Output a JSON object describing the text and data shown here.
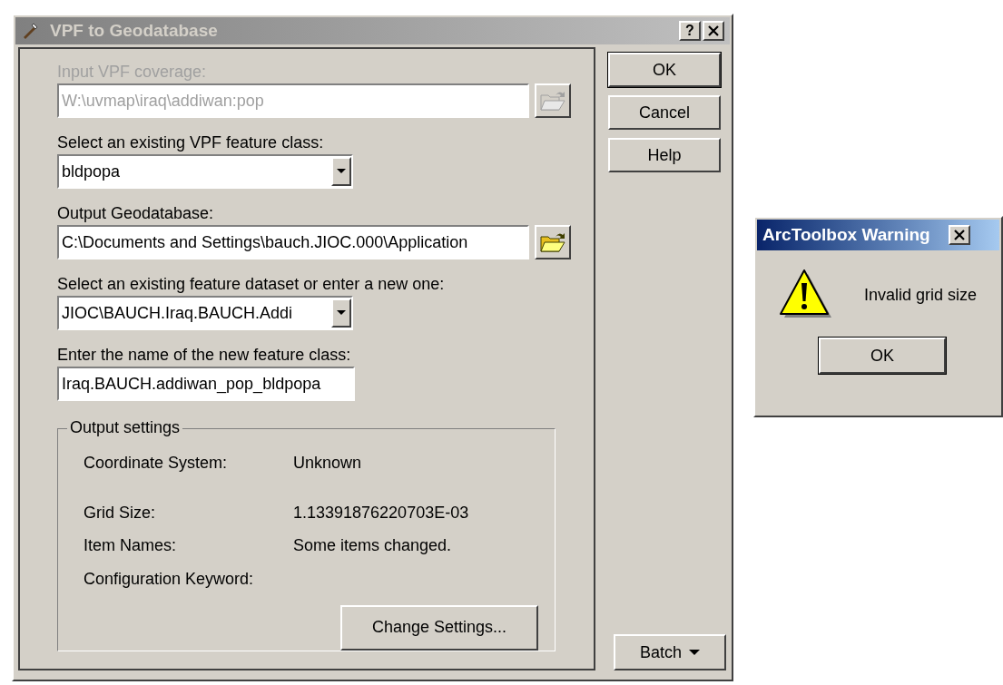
{
  "main_dialog": {
    "title": "VPF to Geodatabase",
    "help_button": "?",
    "fields": [
      {
        "kind": "text",
        "label": "Input VPF coverage:",
        "value": "W:\\uvmap\\iraq\\addiwan:pop",
        "disabled": true,
        "browse": true
      },
      {
        "kind": "dropdown",
        "label": "Select an existing VPF feature class:",
        "value": "bldpopa",
        "disabled": false,
        "browse": false
      },
      {
        "kind": "text",
        "label": "Output Geodatabase:",
        "value": "C:\\Documents and Settings\\bauch.JIOC.000\\Application",
        "disabled": false,
        "browse": true
      },
      {
        "kind": "dropdown",
        "label": "Select an existing feature dataset or enter a new one:",
        "value": "JIOC\\BAUCH.Iraq.BAUCH.Addi",
        "disabled": false,
        "browse": false
      },
      {
        "kind": "short_text",
        "label": "Enter the name of the new feature class:",
        "value": "Iraq.BAUCH.addiwan_pop_bldpopa",
        "disabled": false,
        "browse": false
      }
    ],
    "output_settings": {
      "legend": "Output settings",
      "rows": [
        {
          "label": "Coordinate System:",
          "value": "Unknown"
        },
        {
          "label": "Grid Size:",
          "value": "1.13391876220703E-03"
        },
        {
          "label": "Item Names:",
          "value": "Some items changed."
        },
        {
          "label": "Configuration Keyword:"
        }
      ],
      "button": "Change Settings..."
    },
    "buttons": [
      {
        "label": "OK",
        "default": true
      },
      {
        "label": "Cancel",
        "default": false
      },
      {
        "label": "Help",
        "default": false
      }
    ],
    "batch_button": "Batch"
  },
  "warning_dialog": {
    "title": "ArcToolbox Warning",
    "message": "Invalid grid size",
    "button": "OK"
  }
}
